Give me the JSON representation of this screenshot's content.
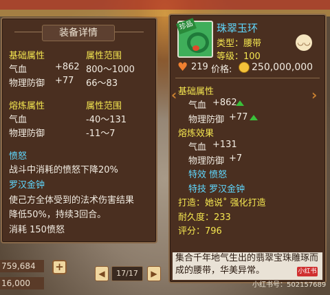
{
  "left_panel": {
    "title": "装备详情",
    "basic_header": "基础属性",
    "range_header": "属性范围",
    "basic_rows": [
      {
        "name": "气血",
        "value": "+862",
        "range": "800～1000"
      },
      {
        "name": "物理防御",
        "value": "+77",
        "range": "66～83"
      }
    ],
    "refine_header": "熔炼属性",
    "refine_range_header": "属性范围",
    "refine_rows": [
      {
        "name": "气血",
        "range": "-40～131"
      },
      {
        "name": "物理防御",
        "range": "-11～7"
      }
    ],
    "anger_title": "愤怒",
    "anger_desc": "战斗中消耗的愤怒下降20%",
    "skill_title": "罗汉金钟",
    "skill_desc_1": "使己方全体受到的法术伤害结果",
    "skill_desc_2": "降低50%，持续3回合。",
    "skill_cost": "消耗  150愤怒"
  },
  "bottom": {
    "value_1": "759,684",
    "value_2": "16,000",
    "plus_label": "+",
    "page": "17/17"
  },
  "right_panel": {
    "rare_tag": "珍品",
    "item_name": "珠翠玉环",
    "type": "类型：腰带",
    "level": "等级：100",
    "likes": "219",
    "price_label": "价格:",
    "price": "250,000,000",
    "basic_header": "基础属性",
    "basic_rows": [
      {
        "name": "气血",
        "value": "+862"
      },
      {
        "name": "物理防御",
        "value": "+77"
      }
    ],
    "refine_header": "熔炼效果",
    "refine_rows": [
      {
        "name": "气血",
        "value": "+131"
      },
      {
        "name": "物理防御",
        "value": "+7"
      }
    ],
    "special_effect": "特效  愤怒",
    "special_skill": "特技  罗汉金钟",
    "forge": "打造：她说˚    强化打造",
    "durability": "耐久度：233",
    "score": "评分：796",
    "description": "集合千年地气生出的翡翠宝珠雕琢而成的腰带，华美异常。"
  },
  "watermark": {
    "badge": "小红书",
    "text": "小红书号：502157689"
  },
  "colors": {
    "panel_bg": "#4a2f20",
    "yellow_label": "#f4e650",
    "cyan_label": "#5fd8ff"
  }
}
